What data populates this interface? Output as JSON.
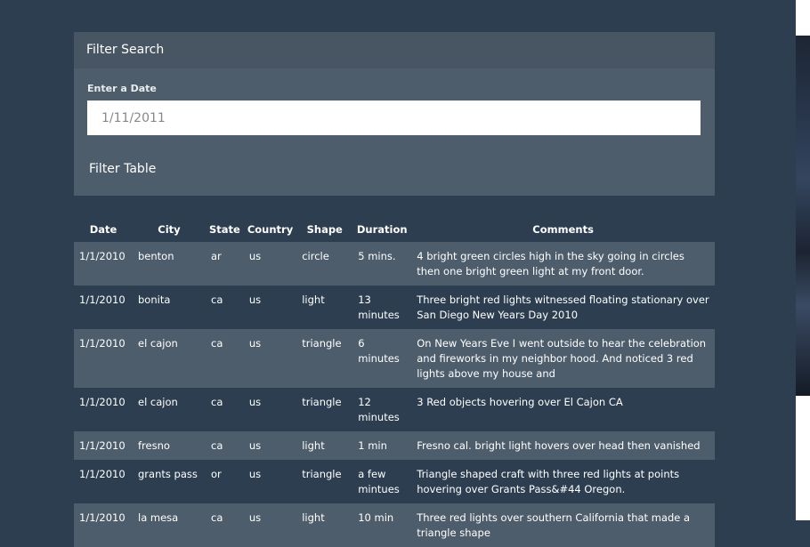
{
  "filter_panel": {
    "heading": "Filter Search",
    "date_label": "Enter a Date",
    "date_placeholder": "1/11/2011",
    "filter_button_label": "Filter Table"
  },
  "table": {
    "headers": [
      "Date",
      "City",
      "State",
      "Country",
      "Shape",
      "Duration",
      "Comments"
    ],
    "rows": [
      {
        "date": "1/1/2010",
        "city": "benton",
        "state": "ar",
        "country": "us",
        "shape": "circle",
        "duration": "5 mins.",
        "comments": "4 bright green circles high in the sky going in circles then one bright green light at my front door."
      },
      {
        "date": "1/1/2010",
        "city": "bonita",
        "state": "ca",
        "country": "us",
        "shape": "light",
        "duration": "13 minutes",
        "comments": "Three bright red lights witnessed floating stationary over San Diego New Years Day 2010"
      },
      {
        "date": "1/1/2010",
        "city": "el cajon",
        "state": "ca",
        "country": "us",
        "shape": "triangle",
        "duration": "6 minutes",
        "comments": "On New Years Eve I went outside to hear the celebration and fireworks in my neighbor hood. And noticed 3 red lights above my house and"
      },
      {
        "date": "1/1/2010",
        "city": "el cajon",
        "state": "ca",
        "country": "us",
        "shape": "triangle",
        "duration": "12 minutes",
        "comments": "3 Red objects hovering over El Cajon CA"
      },
      {
        "date": "1/1/2010",
        "city": "fresno",
        "state": "ca",
        "country": "us",
        "shape": "light",
        "duration": "1 min",
        "comments": "Fresno cal. bright light hovers over head then vanished"
      },
      {
        "date": "1/1/2010",
        "city": "grants pass",
        "state": "or",
        "country": "us",
        "shape": "triangle",
        "duration": "a few mintues",
        "comments": "Triangle shaped craft with three red lights at points hovering over Grants Pass&#44 Oregon."
      },
      {
        "date": "1/1/2010",
        "city": "la mesa",
        "state": "ca",
        "country": "us",
        "shape": "light",
        "duration": "10 min",
        "comments": "Three red lights over southern California that made a triangle shape"
      }
    ]
  }
}
